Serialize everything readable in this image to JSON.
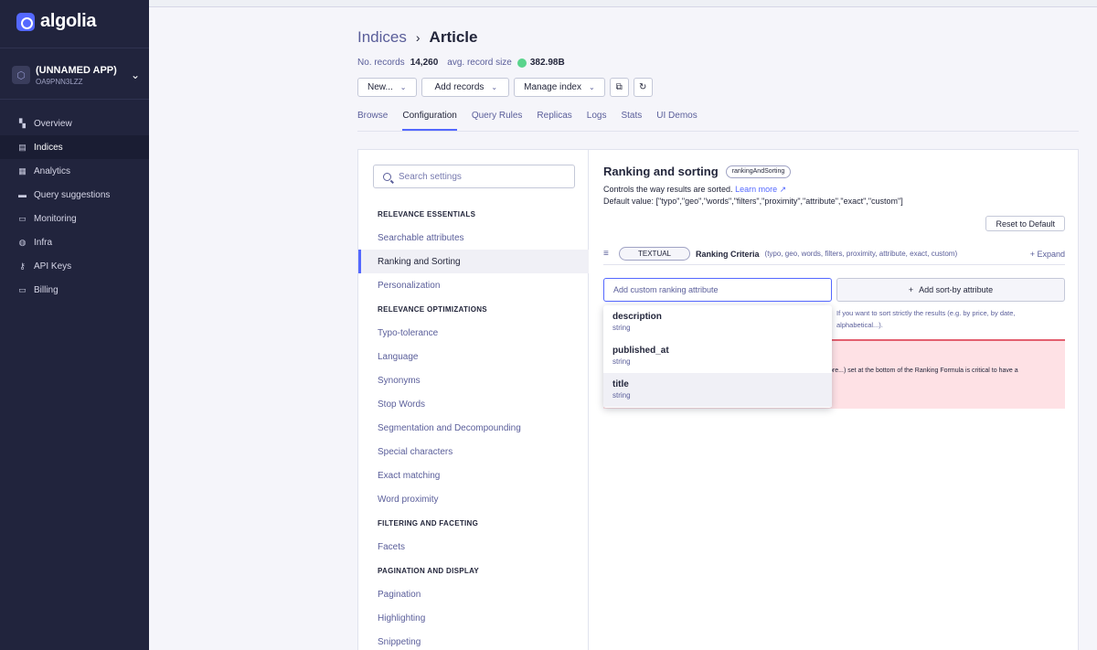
{
  "sidebar": {
    "brand": "algolia",
    "app_name": "(UNNAMED APP)",
    "app_id": "OA9PNN3LZZ",
    "nav": [
      {
        "label": "Overview",
        "icon": "overview-icon"
      },
      {
        "label": "Indices",
        "icon": "indices-icon"
      },
      {
        "label": "Analytics",
        "icon": "analytics-icon"
      },
      {
        "label": "Query suggestions",
        "icon": "query-suggestions-icon"
      },
      {
        "label": "Monitoring",
        "icon": "monitoring-icon"
      },
      {
        "label": "Infra",
        "icon": "infra-icon"
      },
      {
        "label": "API Keys",
        "icon": "key-icon"
      },
      {
        "label": "Billing",
        "icon": "billing-icon"
      }
    ],
    "active": "Indices"
  },
  "header": {
    "breadcrumb_parent": "Indices",
    "breadcrumb_current": "Article",
    "records_label": "No. records",
    "records_value": "14,260",
    "avg_size_label": "avg. record size",
    "avg_size_value": "382.98B"
  },
  "actions": {
    "new_label": "New...",
    "add_records_label": "Add records",
    "manage_index_label": "Manage index"
  },
  "tabs": [
    "Browse",
    "Configuration",
    "Query Rules",
    "Replicas",
    "Logs",
    "Stats",
    "UI Demos"
  ],
  "active_tab": "Configuration",
  "settings": {
    "search_placeholder": "Search settings",
    "sections": [
      {
        "heading": "RELEVANCE ESSENTIALS",
        "items": [
          "Searchable attributes",
          "Ranking and Sorting",
          "Personalization"
        ]
      },
      {
        "heading": "RELEVANCE OPTIMIZATIONS",
        "items": [
          "Typo-tolerance",
          "Language",
          "Synonyms",
          "Stop Words",
          "Segmentation and Decompounding",
          "Special characters",
          "Exact matching",
          "Word proximity"
        ]
      },
      {
        "heading": "FILTERING AND FACETING",
        "items": [
          "Facets"
        ]
      },
      {
        "heading": "PAGINATION AND DISPLAY",
        "items": [
          "Pagination",
          "Highlighting",
          "Snippeting"
        ]
      }
    ],
    "active_item": "Ranking and Sorting"
  },
  "detail": {
    "title": "Ranking and sorting",
    "key_pill": "rankingAndSorting",
    "description": "Controls the way results are sorted.",
    "learn_more": "Learn more",
    "default_value": "Default value: [\"typo\",\"geo\",\"words\",\"filters\",\"proximity\",\"attribute\",\"exact\",\"custom\"]",
    "reset_label": "Reset to Default",
    "criteria_tag": "TEXTUAL",
    "criteria_name": "Ranking Criteria",
    "criteria_sub": "(typo, geo, words, filters, proximity, attribute, exact, custom)",
    "expand_label": "Expand",
    "custom_placeholder": "Add custom ranking attribute",
    "sortby_label": "Add sort-by attribute",
    "sortby_help": "If you want to sort strictly the results (e.g. by price, by date, alphabetical...).",
    "warning_line1": "ore...) set at the bottom of the Ranking Formula is critical to have a",
    "dropdown": [
      {
        "name": "description",
        "type": "string"
      },
      {
        "name": "published_at",
        "type": "string"
      },
      {
        "name": "title",
        "type": "string"
      }
    ]
  },
  "colors": {
    "accent": "#5468ff",
    "sidebar_bg": "#21243d",
    "warning_bg": "#fee1e5",
    "success": "#5ad48c"
  }
}
